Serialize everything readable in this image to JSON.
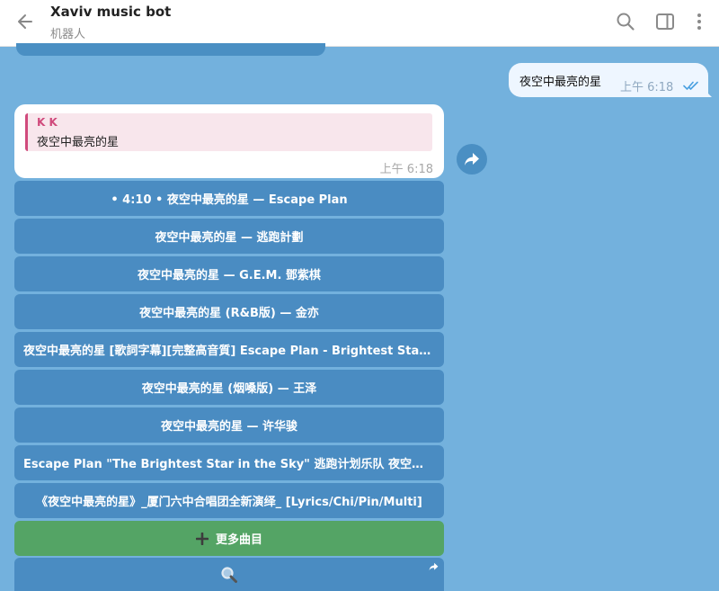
{
  "header": {
    "title": "Xaviv music bot",
    "subtitle": "机器人"
  },
  "outgoing": {
    "text": "夜空中最亮的星",
    "time": "上午 6:18"
  },
  "incoming": {
    "reply_name": "K K",
    "reply_text": "夜空中最亮的星",
    "time": "上午 6:18"
  },
  "keyboard": {
    "buttons": [
      "• 4:10 • 夜空中最亮的星 — Escape Plan",
      "夜空中最亮的星 — 逃跑計劃",
      "夜空中最亮的星 — G.E.M. 鄧紫棋",
      "夜空中最亮的星 (R&B版) — 金亦",
      "夜空中最亮的星 [歌詞字幕][完整高音質] Escape Plan - Brightest Star in the Sky",
      "夜空中最亮的星 (烟嗓版) — 王泽",
      "夜空中最亮的星 — 许华骏",
      "Escape Plan \"The Brightest Star in the Sky\" 逃跑计划乐队 夜空中最亮的星",
      "《夜空中最亮的星》_厦门六中合唱团全新演绎_ [Lyrics/Chi/Pin/Multi]"
    ],
    "more_label": "更多曲目"
  },
  "colors": {
    "chat_background": "#73b1dd",
    "keyboard_button": "#4a8cc2",
    "more_button": "#54a465",
    "reply_accent": "#d04a7c"
  },
  "icons": {
    "back": "arrow-left-icon",
    "search": "search-icon",
    "sidebar": "sidebar-toggle-icon",
    "more": "more-vertical-icon",
    "forward": "forward-icon",
    "read": "double-check-icon",
    "plus": "plus-icon",
    "inline_search": "magnifier-icon"
  }
}
